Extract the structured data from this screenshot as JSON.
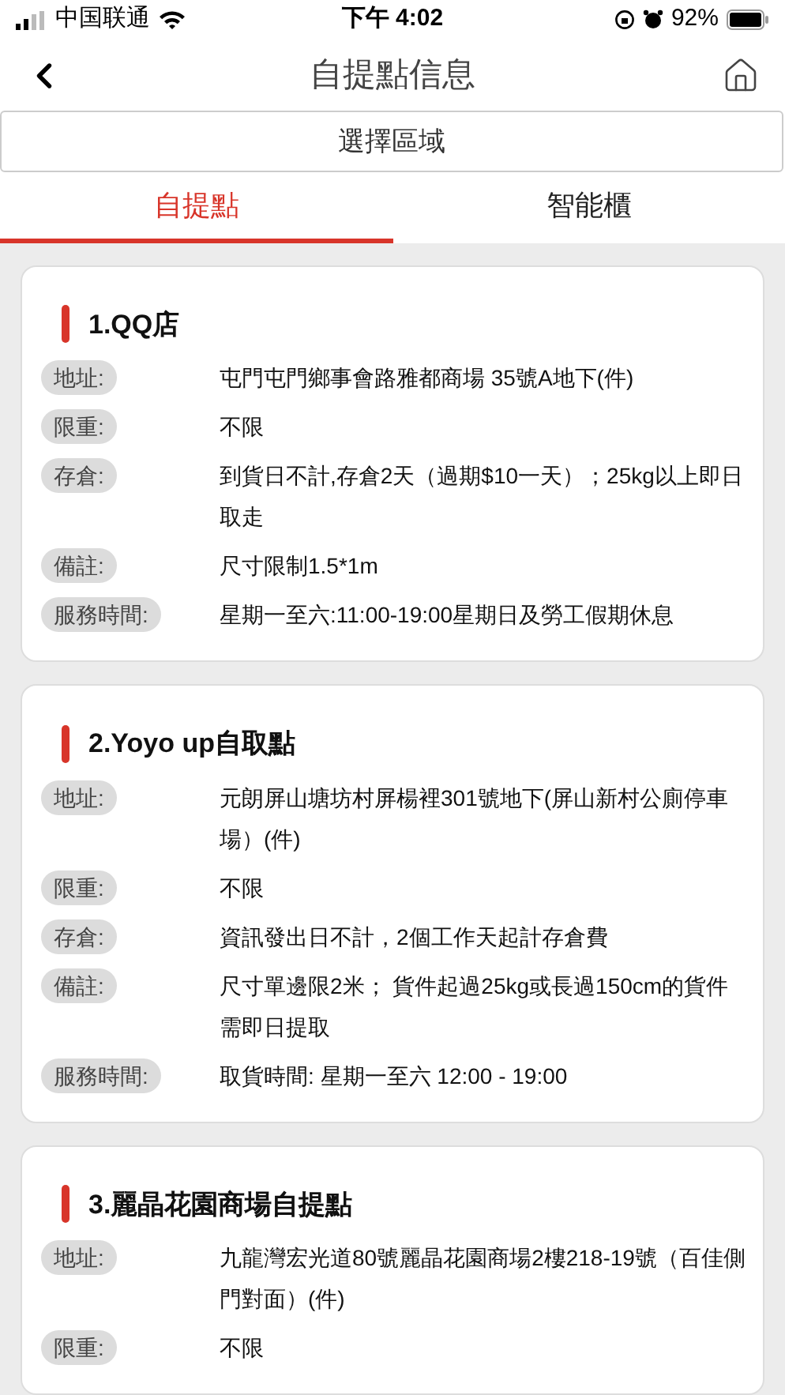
{
  "status_bar": {
    "carrier": "中国联通",
    "time": "下午 4:02",
    "battery": "92%"
  },
  "nav": {
    "title": "自提點信息"
  },
  "region_selector": {
    "label": "選擇區域"
  },
  "tabs": [
    {
      "label": "自提點",
      "selected": true
    },
    {
      "label": "智能櫃",
      "selected": false
    }
  ],
  "stores": [
    {
      "title": "1.QQ店",
      "rows": [
        {
          "label": "地址:",
          "value": "屯門屯門鄉事會路雅都商場 35號A地下(件)"
        },
        {
          "label": "限重:",
          "value": "不限"
        },
        {
          "label": "存倉:",
          "value": "到貨日不計,存倉2天（過期$10一天）；25kg以上即日取走"
        },
        {
          "label": "備註:",
          "value": "尺寸限制1.5*1m"
        },
        {
          "label": "服務時間:",
          "value": "星期一至六:11:00-19:00星期日及勞工假期休息"
        }
      ]
    },
    {
      "title": "2.Yoyo up自取點",
      "rows": [
        {
          "label": "地址:",
          "value": "元朗屏山塘坊村屏楊裡301號地下(屏山新村公廁停車場）(件)"
        },
        {
          "label": "限重:",
          "value": "不限"
        },
        {
          "label": "存倉:",
          "value": "資訊發出日不計，2個工作天起計存倉費"
        },
        {
          "label": "備註:",
          "value": "尺寸單邊限2米； 貨件起過25kg或長過150cm的貨件需即日提取"
        },
        {
          "label": "服務時間:",
          "value": "取貨時間: 星期一至六 12:00 - 19:00"
        }
      ]
    },
    {
      "title": "3.麗晶花園商場自提點",
      "rows": [
        {
          "label": "地址:",
          "value": "九龍灣宏光道80號麗晶花園商場2樓218-19號（百佳側門對面）(件)"
        },
        {
          "label": "限重:",
          "value": "不限"
        }
      ]
    }
  ]
}
